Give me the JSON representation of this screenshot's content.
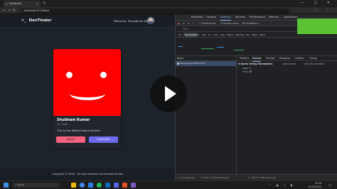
{
  "browser": {
    "tab_title": "Devtinder",
    "url": "localhost:5173/feed"
  },
  "app": {
    "brand": "DevTinder",
    "brand_icon": "terminal-icon",
    "welcome": "Welcome, Sharadindu Das",
    "card": {
      "name": "Shubham Kumar",
      "meta": "19, Male",
      "about": "This is the default about section",
      "ignore_label": "Ignore",
      "interested_label": "Interested",
      "photo_color": "#ff0000"
    },
    "footer": "Copyright © 2026 - All right reserved by Sharadindu Das"
  },
  "devtools": {
    "tabs": [
      "Elements",
      "Console",
      "Sources",
      "Network",
      "Performance",
      "Memory",
      "Application"
    ],
    "active_tab": "Network",
    "toolbar": {
      "preserve_log": "Preserve log",
      "disable_cache": "Disable cache",
      "throttle": "No throttling"
    },
    "filter_placeholder": "Filter",
    "types": [
      "All",
      "Fetch/XHR",
      "Doc",
      "CSS",
      "JS",
      "Font",
      "Img",
      "Media",
      "Manifest",
      "WS",
      "Wasm",
      "Other"
    ],
    "active_type": "Fetch/XHR",
    "name_header": "Name",
    "request": "feed?page=1&limit=10",
    "detail_tabs": [
      "Headers",
      "Payload",
      "Preview",
      "Response",
      "Initiator",
      "Timing"
    ],
    "active_detail_tab": "Payload",
    "query_title": "▼ Query String Parameters",
    "view_source": "view source",
    "view_url_encoded": "view URL-encoded",
    "params": [
      {
        "key": "page",
        "value": "1"
      },
      {
        "key": "limit",
        "value": "10"
      }
    ],
    "status": {
      "requests": "1 / 12 requests",
      "transferred": "1.6 kB / 2.3 kB transferred",
      "resources": "1.7 kB / 3.7 MB resources"
    }
  },
  "taskbar": {
    "search_placeholder": "Search",
    "time": "00:18",
    "date": "10-06-2025"
  }
}
